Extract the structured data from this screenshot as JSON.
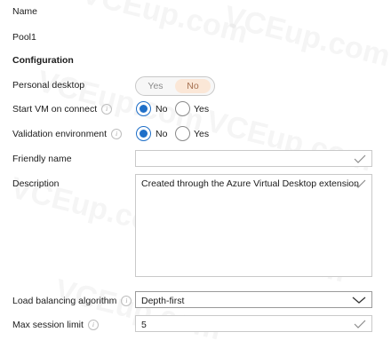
{
  "form": {
    "name_label": "Name",
    "name_value": "Pool1",
    "section_title": "Configuration",
    "personal_desktop": {
      "label": "Personal desktop",
      "options": [
        "Yes",
        "No"
      ],
      "selected": "No"
    },
    "start_vm": {
      "label": "Start VM on connect",
      "options": [
        "No",
        "Yes"
      ],
      "selected": "No"
    },
    "validation_env": {
      "label": "Validation environment",
      "options": [
        "No",
        "Yes"
      ],
      "selected": "No"
    },
    "friendly_name": {
      "label": "Friendly name",
      "value": ""
    },
    "description": {
      "label": "Description",
      "value": "Created through the Azure Virtual Desktop extension"
    },
    "load_balancing": {
      "label": "Load balancing algorithm",
      "value": "Depth-first"
    },
    "max_session": {
      "label": "Max session limit",
      "value": "5"
    }
  },
  "info_glyph": "i",
  "watermark": "VCEup.com",
  "colors": {
    "accent": "#1f6fc8",
    "toggle_selected_bg": "#fbe7d7",
    "check": "#8c8c8c"
  }
}
